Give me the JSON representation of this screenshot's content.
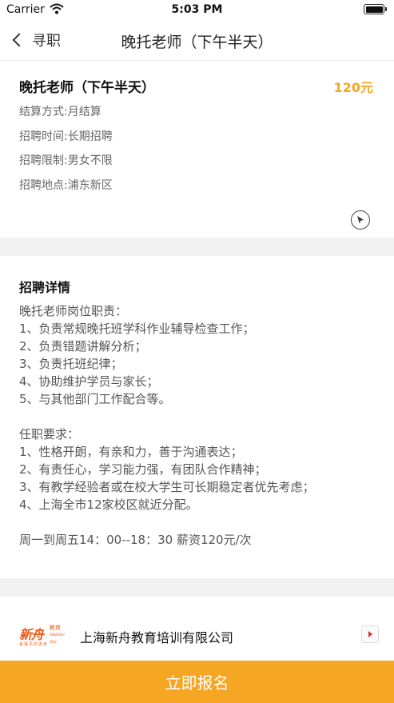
{
  "status_bar": {
    "carrier": "Carrier",
    "time": "5:03 PM"
  },
  "nav": {
    "back_label": "寻职",
    "title": "晚托老师（下午半天）"
  },
  "job": {
    "title": "晚托老师（下午半天）",
    "salary": "120元",
    "settlement": "结算方式:月结算",
    "recruit_time": "招聘时间:长期招聘",
    "restriction": "招聘限制:男女不限",
    "location": "招聘地点:浦东新区"
  },
  "detail": {
    "heading": "招聘详情",
    "body": "晚托老师岗位职责：\n1、负责常规晚托班学科作业辅导检查工作；\n2、负责错题讲解分析；\n3、负责托班纪律；\n4、协助维护学员与家长；\n5、与其他部门工作配合等。\n\n任职要求：\n1、性格开朗，有亲和力，善于沟通表达；\n2、有责任心，学习能力强，有团队合作精神；\n3、有教学经验者或在校大学生可长期稳定者优先考虑；\n4、上海全市12家校区就近分配。\n\n周一到周五14：00--18：30 薪资120元/次"
  },
  "company": {
    "logo_main": "新舟",
    "logo_side": "教育",
    "logo_side_en": "XINZHOU EDU",
    "logo_tag": "看得见的进步",
    "name": "上海新舟教育培训有限公司"
  },
  "apply": {
    "label": "立即报名"
  },
  "colors": {
    "accent": "#f5a623",
    "logo": "#e85c1a"
  }
}
